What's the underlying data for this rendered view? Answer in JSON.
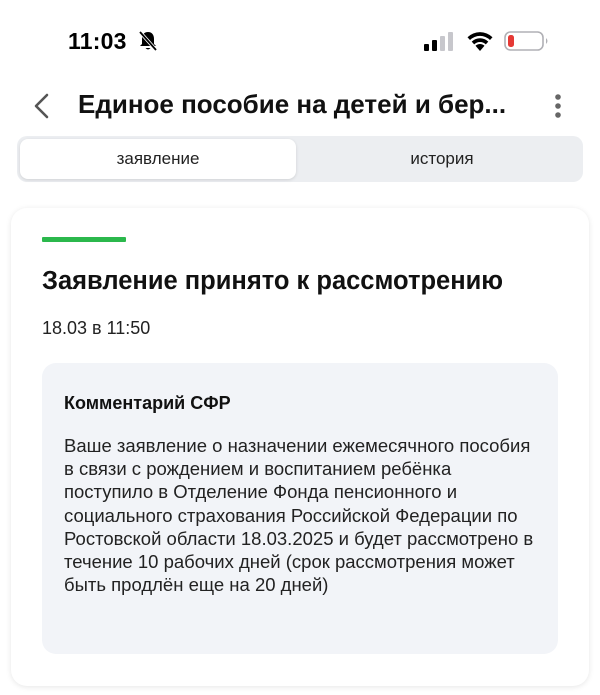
{
  "status_bar": {
    "time": "11:03",
    "icons": [
      "bell-slash-icon",
      "cellular-signal-icon",
      "wifi-icon",
      "battery-low-icon"
    ],
    "battery_color": "#e53935"
  },
  "header": {
    "title": "Единое пособие на детей и бер...",
    "back_icon": "chevron-left-icon",
    "menu_icon": "more-vertical-icon"
  },
  "tabs": [
    {
      "label": "заявление",
      "active": true
    },
    {
      "label": "история",
      "active": false
    }
  ],
  "card": {
    "status_color": "#2bb84c",
    "title": "Заявление принято к рассмотрению",
    "date": "18.03 в 11:50",
    "comment": {
      "title": "Комментарий СФР",
      "text": "Ваше заявление о назначении ежемесячного пособия в связи с рождением и воспитанием ребёнка поступило в Отделение Фонда пенсионного и социального страхования Российской Федерации по Ростовской области 18.03.2025 и будет рассмотрено в течение 10 рабочих дней (срок рассмотрения может быть продлён еще на 20 дней)"
    }
  }
}
